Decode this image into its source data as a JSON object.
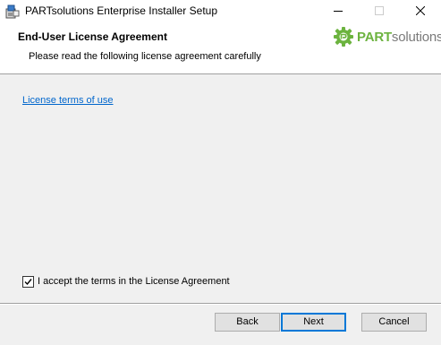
{
  "window": {
    "title": "PARTsolutions Enterprise Installer Setup",
    "icon": "installer-icon",
    "controls": {
      "minimize_icon": "minimize-icon",
      "maximize_icon": "maximize-icon",
      "close_icon": "close-icon"
    }
  },
  "banner": {
    "title": "End-User License Agreement",
    "subtitle": "Please read the following license agreement carefully",
    "logo": {
      "icon": "partsolutions-gear-logo-icon",
      "text_bold": "PART",
      "text_regular": "solutions"
    }
  },
  "content": {
    "license_link": "License terms of use",
    "accept_checkbox": {
      "label": "I accept the terms in the License Agreement",
      "checked": true
    }
  },
  "footer": {
    "back_label": "Back",
    "next_label": "Next",
    "cancel_label": "Cancel"
  },
  "colors": {
    "link": "#0066cc",
    "logo_green": "#6cb33f",
    "logo_gray": "#7a7a7a",
    "focus_border": "#0078d7",
    "dialog_background": "#f0f0f0"
  }
}
